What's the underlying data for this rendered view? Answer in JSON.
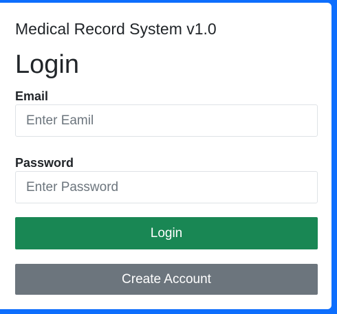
{
  "app": {
    "title": "Medical Record System v1.0"
  },
  "form": {
    "heading": "Login",
    "email": {
      "label": "Email",
      "placeholder": "Enter Eamil",
      "value": ""
    },
    "password": {
      "label": "Password",
      "placeholder": "Enter Password",
      "value": ""
    },
    "login_button": "Login",
    "create_account_button": "Create Account"
  },
  "colors": {
    "page_background": "#0d6efd",
    "card_background": "#ffffff",
    "login_button": "#198754",
    "create_account_button": "#6c757d",
    "text": "#212529"
  }
}
